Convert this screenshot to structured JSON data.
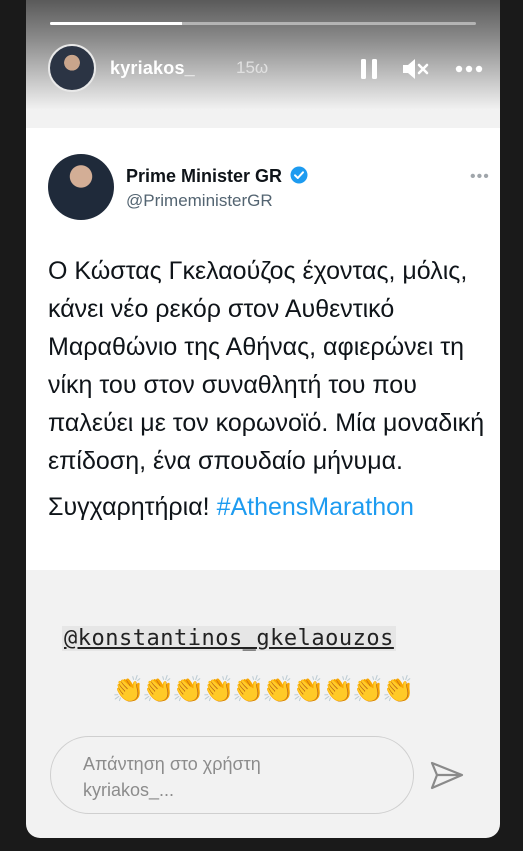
{
  "story": {
    "progress": 0.31,
    "username": "kyriakos_",
    "timestamp": "15ω",
    "icons": [
      "pause-icon",
      "mute-icon",
      "more-icon"
    ]
  },
  "tweet": {
    "name": "Prime Minister GR",
    "handle": "@PrimeministerGR",
    "verified_color": "#1d9bf0",
    "body": "Ο Κώστας Γκελαούζος έχοντας, μόλις, κάνει νέο ρεκόρ στον Αυθεντικό Μαραθώνιο της Αθήνας, αφιερώνει τη νίκη του στον συναθλητή του που παλεύει με τον κορωνοϊό. Μία μοναδική επίδοση, ένα σπουδαίο μήνυμα.",
    "closing": "Συγχαρητήρια!",
    "hashtag": "#AthensMarathon"
  },
  "mention": "@konstantinos_gkelaouzos",
  "clap_count": 10,
  "reply": {
    "placeholder": "Απάντηση στο χρήστη kyriakos_..."
  }
}
